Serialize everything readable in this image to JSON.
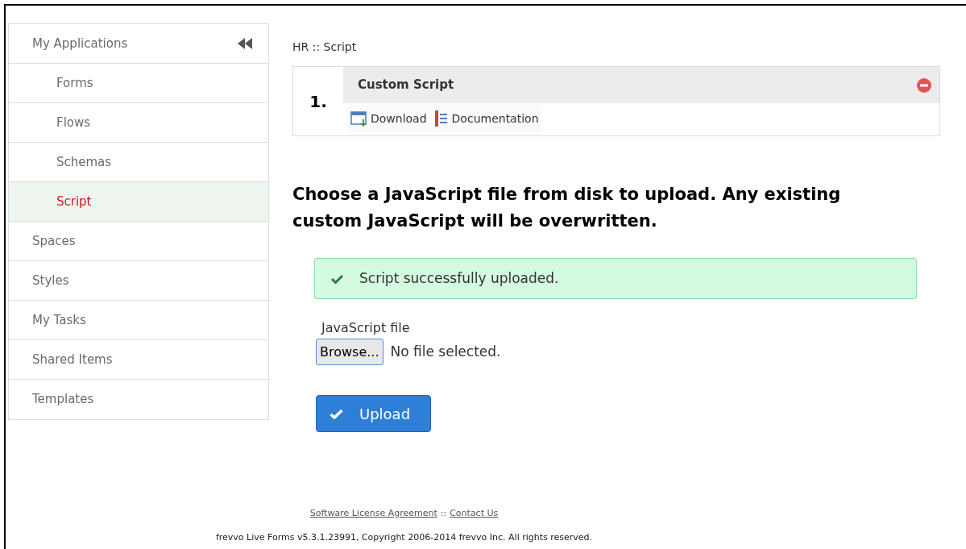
{
  "sidebar": {
    "items": [
      {
        "label": "My Applications",
        "selected": false,
        "children": [
          {
            "label": "Forms",
            "selected": false
          },
          {
            "label": "Flows",
            "selected": false
          },
          {
            "label": "Schemas",
            "selected": false
          },
          {
            "label": "Script",
            "selected": true
          }
        ]
      },
      {
        "label": "Spaces",
        "selected": false
      },
      {
        "label": "Styles",
        "selected": false
      },
      {
        "label": "My Tasks",
        "selected": false
      },
      {
        "label": "Shared Items",
        "selected": false
      },
      {
        "label": "Templates",
        "selected": false
      }
    ]
  },
  "breadcrumb": "HR :: Script",
  "script_card": {
    "number": "1.",
    "title": "Custom Script",
    "actions": [
      "Download",
      "Documentation"
    ]
  },
  "heading": "Choose a JavaScript file from disk to upload. Any existing custom JavaScript will be overwritten.",
  "alert": {
    "message": "Script successfully uploaded."
  },
  "file_field": {
    "label": "JavaScript file",
    "button": "Browse...",
    "status": "No file selected."
  },
  "upload_button": "Upload",
  "footer": {
    "links": [
      "Software License Agreement",
      "Contact Us"
    ],
    "separator": "::",
    "copyright": "frevvo Live Forms v5.3.1.23991, Copyright 2006-2014 frevvo Inc. All rights reserved."
  }
}
